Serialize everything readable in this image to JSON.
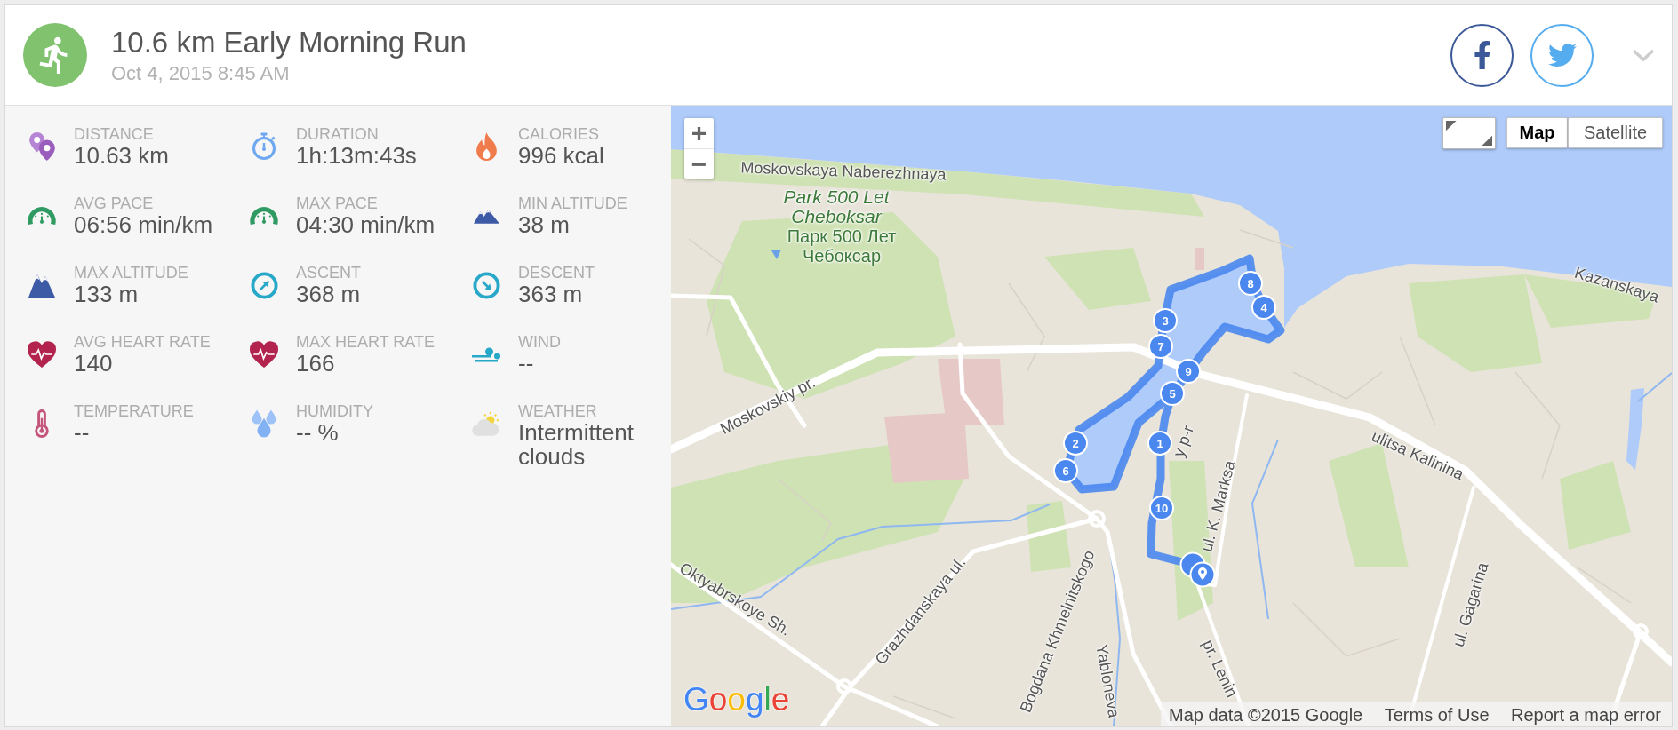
{
  "activity": {
    "title": "10.6 km Early Morning Run",
    "date": "Oct 4, 2015 8:45 AM"
  },
  "stats": [
    {
      "kind": "pins",
      "label": "DISTANCE",
      "value": "10.63 km"
    },
    {
      "kind": "stopwatch",
      "label": "DURATION",
      "value": "1h:13m:43s"
    },
    {
      "kind": "flame",
      "label": "CALORIES",
      "value": "996 kcal"
    },
    {
      "kind": "gauge",
      "label": "AVG PACE",
      "value": "06:56 min/km"
    },
    {
      "kind": "gauge",
      "label": "MAX PACE",
      "value": "04:30 min/km"
    },
    {
      "kind": "hills",
      "label": "MIN ALTITUDE",
      "value": "38 m"
    },
    {
      "kind": "mountains",
      "label": "MAX ALTITUDE",
      "value": "133 m"
    },
    {
      "kind": "ascent",
      "label": "ASCENT",
      "value": "368 m"
    },
    {
      "kind": "descent",
      "label": "DESCENT",
      "value": "363 m"
    },
    {
      "kind": "heart",
      "label": "AVG HEART RATE",
      "value": "140"
    },
    {
      "kind": "heart",
      "label": "MAX HEART RATE",
      "value": "166"
    },
    {
      "kind": "wind",
      "label": "WIND",
      "value": "--"
    },
    {
      "kind": "thermometer",
      "label": "TEMPERATURE",
      "value": "--"
    },
    {
      "kind": "drops",
      "label": "HUMIDITY",
      "value": "-- %"
    },
    {
      "kind": "weather",
      "label": "WEATHER",
      "value": "Intermittent clouds"
    }
  ],
  "map": {
    "zoom_controls": [
      "+",
      "−"
    ],
    "map_types": [
      {
        "label": "Map",
        "selected": true
      },
      {
        "label": "Satellite",
        "selected": false
      }
    ],
    "labels": [
      {
        "kind": "street",
        "text": "Moskovskaya Naberezhnaya"
      },
      {
        "kind": "park",
        "text": "Park 500 Let Cheboksar"
      },
      {
        "kind": "local",
        "text": "Парк 500 Лет Чебоксар"
      },
      {
        "kind": "street",
        "text": "Moskovskiy pr."
      },
      {
        "kind": "street",
        "text": "y p-r"
      },
      {
        "kind": "street",
        "text": "Kazanskaya"
      },
      {
        "kind": "street",
        "text": "ulitsa Kalinina"
      },
      {
        "kind": "street",
        "text": "ul. K. Marksa"
      },
      {
        "kind": "street",
        "text": "pr. Lenin"
      },
      {
        "kind": "street",
        "text": "Bogdana Khmelnitskogo"
      },
      {
        "kind": "street",
        "text": "Yabloneva"
      },
      {
        "kind": "street",
        "text": "Grazhdanskaya ul."
      },
      {
        "kind": "street",
        "text": "Oktyabrskoye Sh."
      },
      {
        "kind": "street",
        "text": "ul. Gagarina"
      }
    ],
    "route_markers": [
      "1",
      "2",
      "3",
      "4",
      "5",
      "6",
      "7",
      "8",
      "9",
      "10"
    ],
    "logo": "Google",
    "attribution": [
      "Map data ©2015 Google",
      "Terms of Use",
      "Report a map error"
    ]
  }
}
